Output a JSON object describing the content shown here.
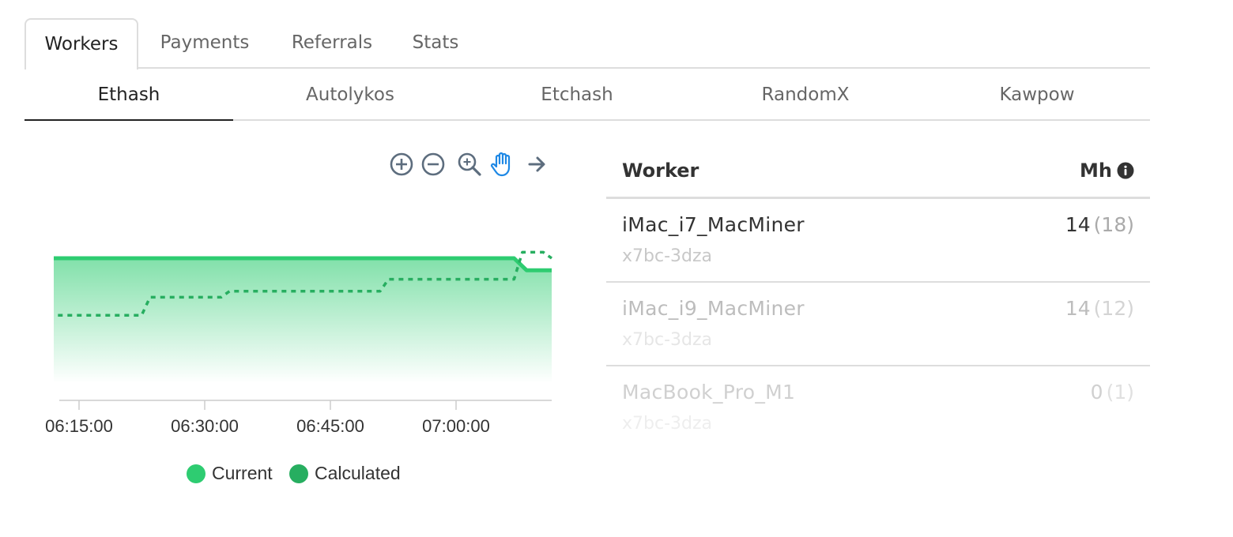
{
  "top_tabs": [
    "Workers",
    "Payments",
    "Referrals",
    "Stats"
  ],
  "algo_tabs": [
    "Ethash",
    "Autolykos",
    "Etchash",
    "RandomX",
    "Kawpow"
  ],
  "toolbar": {
    "icons": [
      "zoom-in-icon",
      "zoom-out-icon",
      "selection-zoom-icon",
      "pan-hand-icon",
      "reset-arrow-icon"
    ],
    "active_color": "#1e88e5",
    "icon_color": "#5d6d7e"
  },
  "chart_data": {
    "type": "area",
    "x_ticks": [
      "06:15:00",
      "06:30:00",
      "06:45:00",
      "07:00:00"
    ],
    "x_range_minutes": [
      12.5,
      72
    ],
    "series": [
      {
        "name": "Current",
        "color": "#2ecc71",
        "style": "solid-area",
        "points": [
          [
            12.5,
            14.0
          ],
          [
            67.5,
            14.0
          ],
          [
            69.0,
            13.6
          ],
          [
            72.0,
            13.6
          ]
        ]
      },
      {
        "name": "Calculated",
        "color": "#27ae60",
        "style": "dashed",
        "points": [
          [
            13.0,
            12.1
          ],
          [
            23.0,
            12.1
          ],
          [
            24.0,
            12.7
          ],
          [
            32.5,
            12.7
          ],
          [
            33.5,
            12.9
          ],
          [
            51.5,
            12.9
          ],
          [
            52.5,
            13.3
          ],
          [
            67.5,
            13.3
          ],
          [
            68.5,
            14.2
          ],
          [
            71.0,
            14.2
          ],
          [
            72.0,
            14.0
          ]
        ]
      }
    ]
  },
  "legend": [
    {
      "label": "Current",
      "color": "#2ecc71"
    },
    {
      "label": "Calculated",
      "color": "#27ae60"
    }
  ],
  "table": {
    "col_worker": "Worker",
    "col_mh": "Mh",
    "rows": [
      {
        "name": "iMac_i7_MacMiner",
        "id": "x7bc-3dza",
        "mh": "14",
        "calc": "(18)",
        "name_color": "#333333",
        "id_color": "#c8c8c8",
        "mh_color": "#333333",
        "calc_color": "#aaaaaa"
      },
      {
        "name": "iMac_i9_MacMiner",
        "id": "x7bc-3dza",
        "mh": "14",
        "calc": "(12)",
        "name_color": "#bdbdbd",
        "id_color": "#e6e6e6",
        "mh_color": "#bdbdbd",
        "calc_color": "#d4d4d4"
      },
      {
        "name": "MacBook_Pro_M1",
        "id": "x7bc-3dza",
        "mh": "0",
        "calc": "(1)",
        "name_color": "#d0d0d0",
        "id_color": "#eeeeee",
        "mh_color": "#d0d0d0",
        "calc_color": "#e0e0e0"
      }
    ]
  }
}
